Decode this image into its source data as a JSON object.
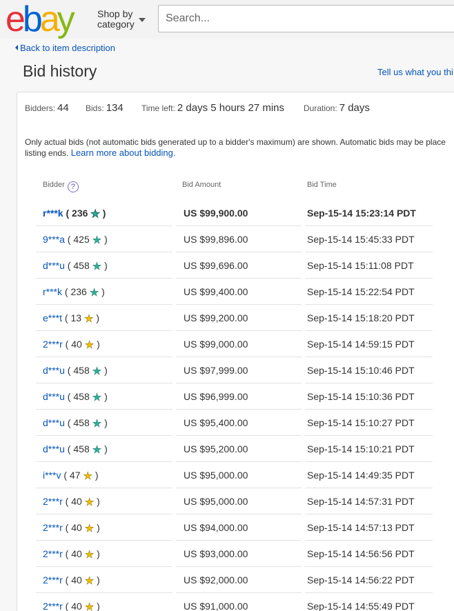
{
  "header": {
    "logo": [
      "e",
      "b",
      "a",
      "y"
    ],
    "shop_by_line1": "Shop by",
    "shop_by_line2": "category",
    "search_placeholder": "Search..."
  },
  "nav": {
    "back_link": "Back to item description",
    "tell_us": "Tell us what you thi"
  },
  "page_title": "Bid history",
  "stats": {
    "bidders_label": "Bidders:",
    "bidders_value": "44",
    "bids_label": "Bids:",
    "bids_value": "134",
    "time_left_label": "Time left:",
    "time_left_value": "2 days 5 hours 27 mins",
    "duration_label": "Duration:",
    "duration_value": "7 days"
  },
  "notice": {
    "text": "Only actual bids (not automatic bids generated up to a bidder's maximum) are shown. Automatic bids may be place",
    "text2": "listing ends.",
    "link": "Learn more about bidding."
  },
  "columns": {
    "bidder": "Bidder",
    "amount": "Bid Amount",
    "time": "Bid Time"
  },
  "colors": {
    "link": "#0654ba",
    "star_teal": "#2fb39b",
    "star_yellow": "#f5c000"
  },
  "rows": [
    {
      "name": "r***k",
      "score": "236",
      "star": "teal",
      "amount": "US $99,900.00",
      "time": "Sep-15-14 15:23:14 PDT",
      "bold": true
    },
    {
      "name": "9***a",
      "score": "425",
      "star": "teal",
      "amount": "US $99,896.00",
      "time": "Sep-15-14 15:45:33 PDT"
    },
    {
      "name": "d***u",
      "score": "458",
      "star": "teal",
      "amount": "US $99,696.00",
      "time": "Sep-15-14 15:11:08 PDT"
    },
    {
      "name": "r***k",
      "score": "236",
      "star": "teal",
      "amount": "US $99,400.00",
      "time": "Sep-15-14 15:22:54 PDT"
    },
    {
      "name": "e***t",
      "score": "13",
      "star": "yellow",
      "amount": "US $99,200.00",
      "time": "Sep-15-14 15:18:20 PDT"
    },
    {
      "name": "2***r",
      "score": "40",
      "star": "yellow",
      "amount": "US $99,000.00",
      "time": "Sep-15-14 14:59:15 PDT"
    },
    {
      "name": "d***u",
      "score": "458",
      "star": "teal",
      "amount": "US $97,999.00",
      "time": "Sep-15-14 15:10:46 PDT"
    },
    {
      "name": "d***u",
      "score": "458",
      "star": "teal",
      "amount": "US $96,999.00",
      "time": "Sep-15-14 15:10:36 PDT"
    },
    {
      "name": "d***u",
      "score": "458",
      "star": "teal",
      "amount": "US $95,400.00",
      "time": "Sep-15-14 15:10:27 PDT"
    },
    {
      "name": "d***u",
      "score": "458",
      "star": "teal",
      "amount": "US $95,200.00",
      "time": "Sep-15-14 15:10:21 PDT"
    },
    {
      "name": "i***v",
      "score": "47",
      "star": "yellow",
      "amount": "US $95,000.00",
      "time": "Sep-15-14 14:49:35 PDT"
    },
    {
      "name": "2***r",
      "score": "40",
      "star": "yellow",
      "amount": "US $95,000.00",
      "time": "Sep-15-14 14:57:31 PDT"
    },
    {
      "name": "2***r",
      "score": "40",
      "star": "yellow",
      "amount": "US $94,000.00",
      "time": "Sep-15-14 14:57:13 PDT"
    },
    {
      "name": "2***r",
      "score": "40",
      "star": "yellow",
      "amount": "US $93,000.00",
      "time": "Sep-15-14 14:56:56 PDT"
    },
    {
      "name": "2***r",
      "score": "40",
      "star": "yellow",
      "amount": "US $92,000.00",
      "time": "Sep-15-14 14:56:22 PDT"
    },
    {
      "name": "2***r",
      "score": "40",
      "star": "yellow",
      "amount": "US $91,000.00",
      "time": "Sep-15-14 14:55:49 PDT"
    }
  ]
}
